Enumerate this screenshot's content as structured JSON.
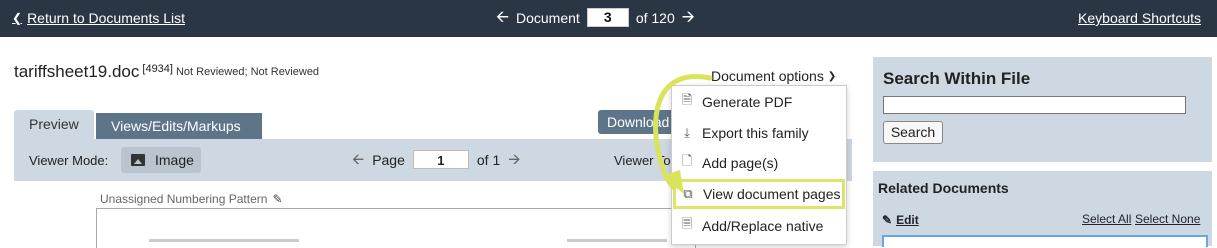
{
  "topbar": {
    "return_label": "Return to Documents List",
    "document_label": "Document",
    "document_number": "3",
    "of_total": "of 120",
    "shortcuts_label": "Keyboard Shortcuts"
  },
  "document": {
    "filename": "tariffsheet19.doc",
    "id": "[4934]",
    "review_status": "Not Reviewed; Not Reviewed",
    "options_label": "Document options"
  },
  "tabs": [
    {
      "label": "Preview"
    },
    {
      "label": "Views/Edits/Markups"
    }
  ],
  "download_label": "Download",
  "viewer": {
    "mode_label": "Viewer Mode:",
    "mode_value": "Image",
    "page_label": "Page",
    "page_number": "1",
    "page_of": "of 1",
    "tools_label": "Viewer To"
  },
  "numbering_label": "Unassigned Numbering Pattern",
  "menu": {
    "items": [
      {
        "label": "Generate PDF",
        "icon": "pdf-icon"
      },
      {
        "label": "Export this family",
        "icon": "download-icon"
      },
      {
        "label": "Add page(s)",
        "icon": "add-page-icon"
      },
      {
        "label": "View document pages",
        "icon": "copy-pages-icon"
      },
      {
        "label": "Add/Replace native",
        "icon": "replace-file-icon"
      }
    ],
    "highlight_color": "#dce56a"
  },
  "search_panel": {
    "title": "Search Within File",
    "input_value": "",
    "button_label": "Search"
  },
  "related_panel": {
    "title": "Related Documents",
    "edit_label": "Edit",
    "select_all": "Select All",
    "select_none": "Select None"
  },
  "colors": {
    "topbar": "#2b3645",
    "panel": "#ced8e2",
    "tab_active": "#5e7489",
    "annotation": "#d9e45c"
  }
}
